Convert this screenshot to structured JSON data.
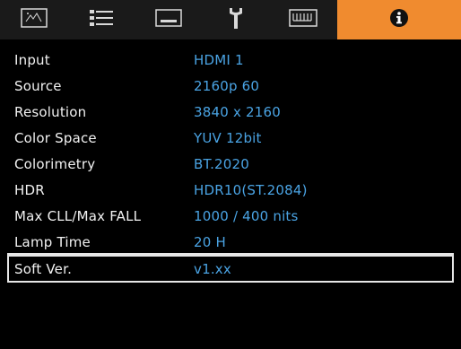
{
  "tabs": [
    {
      "icon": "picture-icon"
    },
    {
      "icon": "settings-list-icon"
    },
    {
      "icon": "screen-icon"
    },
    {
      "icon": "wrench-icon"
    },
    {
      "icon": "keyboard-icon"
    },
    {
      "icon": "info-icon",
      "active": true
    }
  ],
  "colors": {
    "active_tab": "#f08b2f",
    "label": "#f2f2f2",
    "value": "#4aa3e3",
    "tabbar": "#1a1a1a",
    "background": "#000000"
  },
  "info": {
    "rows": [
      {
        "label": "Input",
        "value": "HDMI 1"
      },
      {
        "label": "Source",
        "value": "2160p 60"
      },
      {
        "label": "Resolution",
        "value": "3840 x 2160"
      },
      {
        "label": "Color Space",
        "value": "YUV 12bit"
      },
      {
        "label": "Colorimetry",
        "value": "BT.2020"
      },
      {
        "label": "HDR",
        "value": "HDR10(ST.2084)"
      },
      {
        "label": "Max CLL/Max FALL",
        "value": "1000 / 400 nits"
      },
      {
        "label": "Lamp Time",
        "value": "20 H"
      },
      {
        "label": "Soft Ver.",
        "value": "v1.xx",
        "selected": true
      }
    ]
  }
}
